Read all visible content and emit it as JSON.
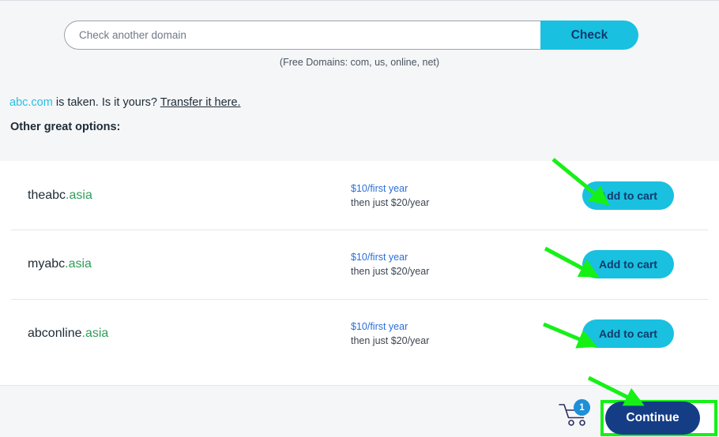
{
  "search": {
    "placeholder": "Check another domain",
    "value": "",
    "check_label": "Check",
    "free_domains_note": "(Free Domains: com, us, online, net)"
  },
  "status": {
    "taken_domain": "abc.com",
    "taken_text": " is taken. Is it yours? ",
    "transfer_link": "Transfer it here.",
    "other_options_label": "Other great options:"
  },
  "results": [
    {
      "sld": "theabc",
      "tld": ".asia",
      "price_first": "$10/first year",
      "price_then": "then just $20/year",
      "add_label": "Add to cart"
    },
    {
      "sld": "myabc",
      "tld": ".asia",
      "price_first": "$10/first year",
      "price_then": "then just $20/year",
      "add_label": "Add to cart"
    },
    {
      "sld": "abconline",
      "tld": ".asia",
      "price_first": "$10/first year",
      "price_then": "then just $20/year",
      "add_label": "Add to cart"
    }
  ],
  "footer": {
    "cart_count": "1",
    "continue_label": "Continue"
  },
  "colors": {
    "cyan_accent": "#19c0e0",
    "navy_text": "#11386e",
    "continue_navy": "#143d86",
    "tld_green": "#2f9c5a",
    "price_blue": "#2a6fd6",
    "link_cyan": "#25c2e4",
    "annotation_green": "#17f017",
    "panel_gray": "#f5f6f8",
    "badge_blue": "#1f8fd6"
  }
}
